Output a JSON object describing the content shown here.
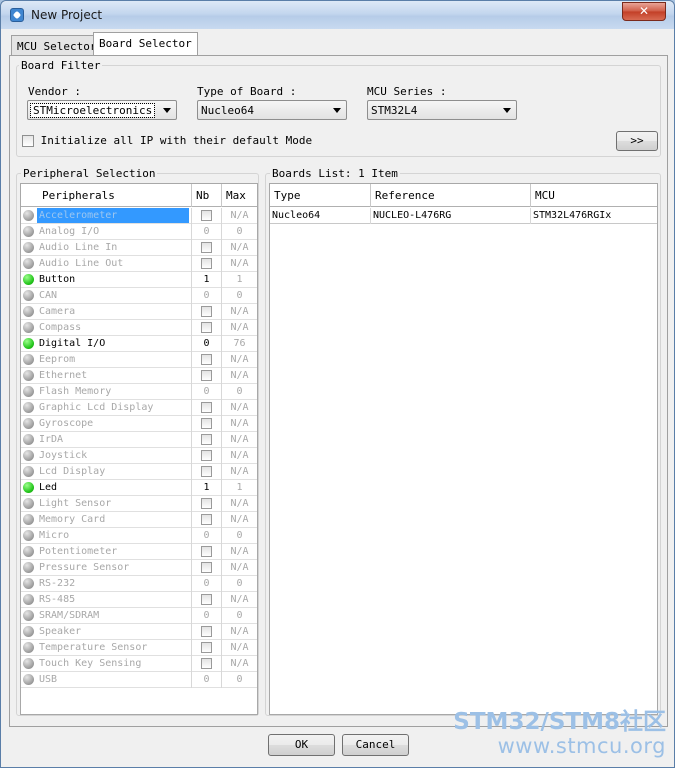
{
  "window": {
    "title": "New Project",
    "close_glyph": "✕"
  },
  "tabs": [
    {
      "label": "MCU Selector",
      "active": false
    },
    {
      "label": "Board Selector",
      "active": true
    }
  ],
  "board_filter": {
    "title": "Board Filter",
    "vendor_label": "Vendor :",
    "vendor_value": "STMicroelectronics",
    "type_label": "Type of Board :",
    "type_value": "Nucleo64",
    "series_label": "MCU Series :",
    "series_value": "STM32L4",
    "init_checkbox_label": "Initialize all IP with their default Mode",
    "init_checked": false,
    "expand_button": ">>"
  },
  "peripheral_selection": {
    "title": "Peripheral Selection",
    "columns": [
      "Peripherals",
      "Nb",
      "Max"
    ],
    "rows": [
      {
        "name": "Accelerometer",
        "status": "grey",
        "nb_type": "checkbox",
        "nb": "",
        "max": "N/A",
        "selected": true
      },
      {
        "name": "Analog I/O",
        "status": "grey",
        "nb_type": "text",
        "nb": "0",
        "max": "0"
      },
      {
        "name": "Audio Line In",
        "status": "grey",
        "nb_type": "checkbox",
        "nb": "",
        "max": "N/A"
      },
      {
        "name": "Audio Line Out",
        "status": "grey",
        "nb_type": "checkbox",
        "nb": "",
        "max": "N/A"
      },
      {
        "name": "Button",
        "status": "green",
        "nb_type": "text",
        "nb": "1",
        "max": "1"
      },
      {
        "name": "CAN",
        "status": "grey",
        "nb_type": "text",
        "nb": "0",
        "max": "0"
      },
      {
        "name": "Camera",
        "status": "grey",
        "nb_type": "checkbox",
        "nb": "",
        "max": "N/A"
      },
      {
        "name": "Compass",
        "status": "grey",
        "nb_type": "checkbox",
        "nb": "",
        "max": "N/A"
      },
      {
        "name": "Digital I/O",
        "status": "green",
        "nb_type": "text",
        "nb": "0",
        "max": "76"
      },
      {
        "name": "Eeprom",
        "status": "grey",
        "nb_type": "checkbox",
        "nb": "",
        "max": "N/A"
      },
      {
        "name": "Ethernet",
        "status": "grey",
        "nb_type": "checkbox",
        "nb": "",
        "max": "N/A"
      },
      {
        "name": "Flash Memory",
        "status": "grey",
        "nb_type": "text",
        "nb": "0",
        "max": "0"
      },
      {
        "name": "Graphic Lcd Display",
        "status": "grey",
        "nb_type": "checkbox",
        "nb": "",
        "max": "N/A"
      },
      {
        "name": "Gyroscope",
        "status": "grey",
        "nb_type": "checkbox",
        "nb": "",
        "max": "N/A"
      },
      {
        "name": "IrDA",
        "status": "grey",
        "nb_type": "checkbox",
        "nb": "",
        "max": "N/A"
      },
      {
        "name": "Joystick",
        "status": "grey",
        "nb_type": "checkbox",
        "nb": "",
        "max": "N/A"
      },
      {
        "name": "Lcd Display",
        "status": "grey",
        "nb_type": "checkbox",
        "nb": "",
        "max": "N/A"
      },
      {
        "name": "Led",
        "status": "green",
        "nb_type": "text",
        "nb": "1",
        "max": "1"
      },
      {
        "name": "Light Sensor",
        "status": "grey",
        "nb_type": "checkbox",
        "nb": "",
        "max": "N/A"
      },
      {
        "name": "Memory Card",
        "status": "grey",
        "nb_type": "checkbox",
        "nb": "",
        "max": "N/A"
      },
      {
        "name": "Micro",
        "status": "grey",
        "nb_type": "text",
        "nb": "0",
        "max": "0"
      },
      {
        "name": "Potentiometer",
        "status": "grey",
        "nb_type": "checkbox",
        "nb": "",
        "max": "N/A"
      },
      {
        "name": "Pressure Sensor",
        "status": "grey",
        "nb_type": "checkbox",
        "nb": "",
        "max": "N/A"
      },
      {
        "name": "RS-232",
        "status": "grey",
        "nb_type": "text",
        "nb": "0",
        "max": "0"
      },
      {
        "name": "RS-485",
        "status": "grey",
        "nb_type": "checkbox",
        "nb": "",
        "max": "N/A"
      },
      {
        "name": "SRAM/SDRAM",
        "status": "grey",
        "nb_type": "text",
        "nb": "0",
        "max": "0"
      },
      {
        "name": "Speaker",
        "status": "grey",
        "nb_type": "checkbox",
        "nb": "",
        "max": "N/A"
      },
      {
        "name": "Temperature Sensor",
        "status": "grey",
        "nb_type": "checkbox",
        "nb": "",
        "max": "N/A"
      },
      {
        "name": "Touch Key Sensing",
        "status": "grey",
        "nb_type": "checkbox",
        "nb": "",
        "max": "N/A"
      },
      {
        "name": "USB",
        "status": "grey",
        "nb_type": "text",
        "nb": "0",
        "max": "0"
      }
    ]
  },
  "boards_list": {
    "title": "Boards List: 1 Item",
    "columns": [
      "Type",
      "Reference",
      "MCU"
    ],
    "rows": [
      {
        "type": "Nucleo64",
        "reference": "NUCLEO-L476RG",
        "mcu": "STM32L476RGIx"
      }
    ]
  },
  "footer": {
    "ok_label": "OK",
    "cancel_label": "Cancel"
  },
  "watermark": {
    "line1": "STM32/STM8社区",
    "line2": "www.stmcu.org"
  },
  "colors": {
    "selection": "#3399ff",
    "status_on": "#22c41a",
    "status_off": "#9a9a9a",
    "watermark": "#9cc0e6"
  }
}
